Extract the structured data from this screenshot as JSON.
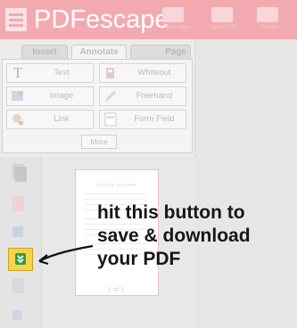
{
  "app": {
    "logo_text": "PDFescape"
  },
  "header_buttons": [
    {
      "icon": "folder-plus-icon",
      "caption": "Create New"
    },
    {
      "icon": "upload-icon",
      "caption": "Upload PDF"
    },
    {
      "icon": "history-icon",
      "caption": "Recent"
    }
  ],
  "tabs": [
    {
      "label": "Insert",
      "active": false
    },
    {
      "label": "Annotate",
      "active": true
    },
    {
      "label": "Page",
      "active": false
    }
  ],
  "tools": [
    {
      "label": "Text",
      "icon": "text-icon"
    },
    {
      "label": "Whiteout",
      "icon": "whiteout-icon"
    },
    {
      "label": "Image",
      "icon": "image-icon"
    },
    {
      "label": "Freehand",
      "icon": "pencil-icon"
    },
    {
      "label": "Link",
      "icon": "link-icon"
    },
    {
      "label": "Form Field",
      "icon": "form-field-icon"
    }
  ],
  "more_label": "More",
  "document": {
    "title": "Example Worksheet",
    "page_indicator": "1 of 1"
  },
  "save_button_icon": "download-chevron-icon",
  "annotation": {
    "lines": [
      "hit this button to",
      "save & download",
      "your PDF"
    ]
  },
  "colors": {
    "header": "#f2aab0",
    "save_button": "#f7d24a",
    "save_icon": "#2e9d4a"
  }
}
